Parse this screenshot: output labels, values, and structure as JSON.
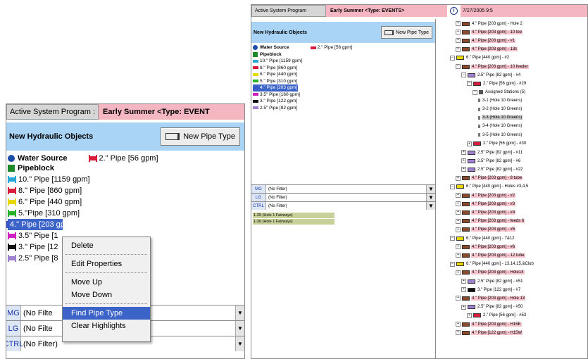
{
  "left": {
    "program_label": "Active System Program :",
    "program_value": "Early Summer   <Type: EVENT",
    "objects_title": "New Hydraulic Objects",
    "new_pipe_button": "New Pipe Type",
    "water_source": "Water Source",
    "pipeblock": "Pipeblock",
    "two_inch_pipe": "2.\" Pipe [56 gpm]",
    "pipes": [
      {
        "label": "10.\" Pipe [1159 gpm]",
        "color": "#29a8d8"
      },
      {
        "label": "8.\" Pipe [860 gpm]",
        "color": "#d81c3c"
      },
      {
        "label": "6.\" Pipe [440 gpm]",
        "color": "#e8d800"
      },
      {
        "label": "5.\"Pipe [310 gpm]",
        "color": "#28b028"
      },
      {
        "label": "4.\" Pipe [203 gpm]",
        "color": "#3a55c8"
      },
      {
        "label": "3.5\" Pipe [1",
        "color": "#d020c0"
      },
      {
        "label": "3.\" Pipe [12",
        "color": "#111111"
      },
      {
        "label": "2.5\" Pipe [8",
        "color": "#a080d0"
      }
    ],
    "filters": [
      {
        "label": "MG",
        "value": "(No Filte"
      },
      {
        "label": "LG",
        "value": "(No Filte"
      },
      {
        "label": "CTRL",
        "value": "(No Filter)"
      }
    ],
    "menu": [
      "Delete",
      "Edit Properties",
      "Move Up",
      "Move Down",
      "Find Pipe Type",
      "Clear Highlights"
    ]
  },
  "right": {
    "program_label": "Active System Program",
    "program_value": "Early Summer   <Type: EVENTS>",
    "datetime": "7/27/2005 9:5",
    "objects_title": "New Hydraulic Objects",
    "new_pipe_button": "New Pipe Type",
    "water_source": "Water Source",
    "pipeblock": "Pipeblock",
    "two_inch_pipe": "2.\" Pipe [56 gpm]",
    "pipes": [
      {
        "label": "10.\" Pipe [1159 gpm]",
        "color": "#29a8d8"
      },
      {
        "label": "8.\" Pipe [860 gpm]",
        "color": "#d81c3c"
      },
      {
        "label": "6.\" Pipe [440 gpm]",
        "color": "#e8d800"
      },
      {
        "label": "5.\" Pipe [310 gpm]",
        "color": "#28b028"
      },
      {
        "label": "4.\" Pipe [203 gpm]",
        "color": "#3a55c8"
      },
      {
        "label": "3.5\" Pipe [160 gpm]",
        "color": "#d020c0"
      },
      {
        "label": "3.\" Pipe [122 gpm]",
        "color": "#111111"
      },
      {
        "label": "2.5\" Pipe [82 gpm]",
        "color": "#a080d0"
      }
    ],
    "filters": [
      {
        "label": "MG",
        "value": "(No Filter)"
      },
      {
        "label": "LG",
        "value": "(No Filter)"
      },
      {
        "label": "CTRL",
        "value": "(No Filter)"
      }
    ],
    "list_items": [
      "1-25 (Hole 1 Fairways)",
      "1-26 (Hole 1 Fairways)"
    ],
    "tree": [
      {
        "text": "4.\" Pipe [203 gpm] - Hole 2",
        "kind": "pipe4",
        "hl": ""
      },
      {
        "text": "4.\" Pipe [203 gpm] - 10 tee",
        "kind": "pipe4",
        "hl": "pink"
      },
      {
        "text": "4.\" Pipe [203 gpm] - #1",
        "kind": "pipe4",
        "hl": "pink"
      },
      {
        "text": "4.\" Pipe [203 gpm] - 13s",
        "kind": "pipe4",
        "hl": "pink"
      },
      {
        "text": "6.\" Pipe [440 gpm] - #2",
        "kind": "pipe6",
        "hl": ""
      },
      {
        "text": "4.\" Pipe [203 gpm] - 10 feeder",
        "kind": "pipe4",
        "hl": "pink"
      },
      {
        "text": "2.5\" Pipe [82 gpm] - #4",
        "kind": "pipe25",
        "hl": ""
      },
      {
        "text": "2.\" Pipe [56 gpm] - #29",
        "kind": "pipe2",
        "hl": ""
      },
      {
        "text": "Assigned Stations (5)",
        "kind": "stations",
        "hl": ""
      },
      {
        "text": "3-1 (Hole 10 Greens)",
        "kind": "station",
        "hl": ""
      },
      {
        "text": "3-2 (Hole 10 Greens)",
        "kind": "station",
        "hl": ""
      },
      {
        "text": "3-3 (Hole 10 Greens)",
        "kind": "station",
        "hl": "grey"
      },
      {
        "text": "3-4 (Hole 10 Greens)",
        "kind": "station",
        "hl": ""
      },
      {
        "text": "3-5 (Hole 10 Greens)",
        "kind": "station",
        "hl": ""
      },
      {
        "text": "2.\" Pipe [56 gpm] - #30",
        "kind": "pipe2",
        "hl": ""
      },
      {
        "text": "2.5\" Pipe [82 gpm] - #11",
        "kind": "pipe25",
        "hl": ""
      },
      {
        "text": "2.5\" Pipe [82 gpm] - #6",
        "kind": "pipe25",
        "hl": ""
      },
      {
        "text": "2.5\" Pipe [82 gpm] - #22",
        "kind": "pipe25",
        "hl": ""
      },
      {
        "text": "4.\" Pipe [203 gpm] - 8 tube",
        "kind": "pipe4",
        "hl": "pink"
      },
      {
        "text": "6.\" Pipe [440 gpm] - Holes #3,4,5",
        "kind": "pipe6",
        "hl": ""
      },
      {
        "text": "4.\" Pipe [203 gpm] - #2",
        "kind": "pipe4",
        "hl": "pink"
      },
      {
        "text": "4.\" Pipe [203 gpm] - #3",
        "kind": "pipe4",
        "hl": "pink"
      },
      {
        "text": "4.\" Pipe [203 gpm] - #4",
        "kind": "pipe4",
        "hl": "pink"
      },
      {
        "text": "4.\" Pipe [203 gpm] - feeds 6",
        "kind": "pipe4",
        "hl": "pink"
      },
      {
        "text": "4.\" Pipe [203 gpm] - #5",
        "kind": "pipe4",
        "hl": "pink"
      },
      {
        "text": "6.\" Pipe [440 gpm] - 7&12",
        "kind": "pipe6",
        "hl": ""
      },
      {
        "text": "4.\" Pipe [203 gpm] - #6",
        "kind": "pipe4",
        "hl": "pink"
      },
      {
        "text": "4.\" Pipe [203 gpm] - 12 tube",
        "kind": "pipe4",
        "hl": "pink"
      },
      {
        "text": "6.\" Pipe [440 gpm] - 13,14,15,&Club",
        "kind": "pipe6",
        "hl": ""
      },
      {
        "text": "4.\" Pipe [203 gpm] - Hole14",
        "kind": "pipe4",
        "hl": "pink"
      },
      {
        "text": "2.5\" Pipe [82 gpm] - #51",
        "kind": "pipe25",
        "hl": ""
      },
      {
        "text": "3.\" Pipe [122 gpm] - #7",
        "kind": "pipe3",
        "hl": ""
      },
      {
        "text": "4.\" Pipe [203 gpm] - Hole 13",
        "kind": "pipe4",
        "hl": "pink"
      },
      {
        "text": "2.5\" Pipe [82 gpm] - #50",
        "kind": "pipe25",
        "hl": ""
      },
      {
        "text": "2.\" Pipe [56 gpm] - #53",
        "kind": "pipe2",
        "hl": ""
      },
      {
        "text": "4.\" Pipe [203 gpm] - H15E",
        "kind": "pipe4",
        "hl": "pink"
      },
      {
        "text": "4.\" Pipe [122 gpm] - H15W",
        "kind": "pipe4",
        "hl": "pink"
      }
    ]
  },
  "colors": {
    "program_bg": "#f4b6c0",
    "header_blue": "#a9d4f5",
    "selection": "#3c64c8",
    "pipe4": "#8c4a2a",
    "pipe6": "#e8d800",
    "pipe25": "#a080d0",
    "pipe2": "#d81c3c",
    "pipe3": "#111111"
  }
}
